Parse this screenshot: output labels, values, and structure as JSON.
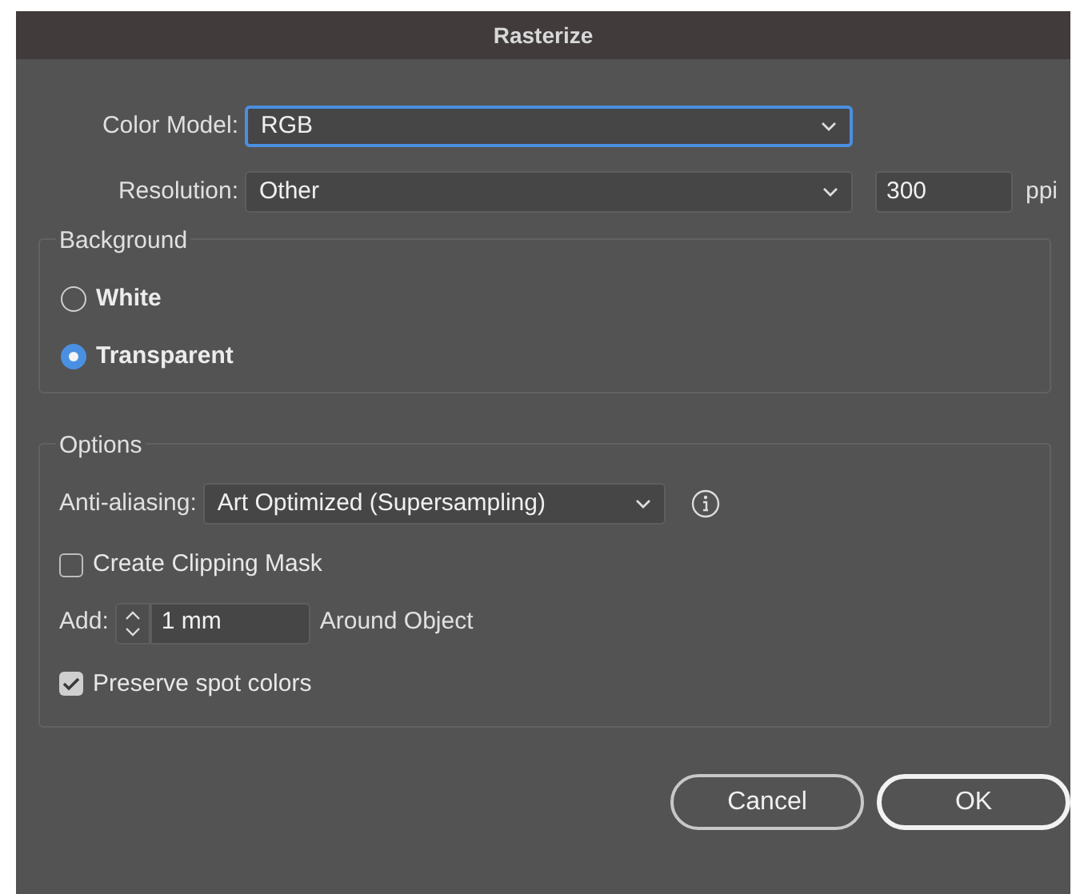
{
  "window": {
    "title": "Rasterize"
  },
  "color_model": {
    "label": "Color Model:",
    "value": "RGB",
    "focused": true
  },
  "resolution": {
    "label": "Resolution:",
    "value": "Other",
    "focused": false,
    "ppi_value": "300",
    "unit": "ppi"
  },
  "background": {
    "title": "Background",
    "options": [
      {
        "label": "White",
        "selected": false
      },
      {
        "label": "Transparent",
        "selected": true
      }
    ]
  },
  "options": {
    "title": "Options",
    "anti_aliasing": {
      "label": "Anti-aliasing:",
      "value": "Art Optimized (Supersampling)"
    },
    "checkboxes": [
      {
        "label": "Create Clipping Mask",
        "checked": false
      },
      {
        "label": "Preserve spot colors",
        "checked": true
      }
    ],
    "add": {
      "label": "Add:",
      "value": "1 mm",
      "suffix": "Around Object"
    }
  },
  "buttons": [
    {
      "label": "Cancel",
      "default": false
    },
    {
      "label": "OK",
      "default": true
    }
  ]
}
